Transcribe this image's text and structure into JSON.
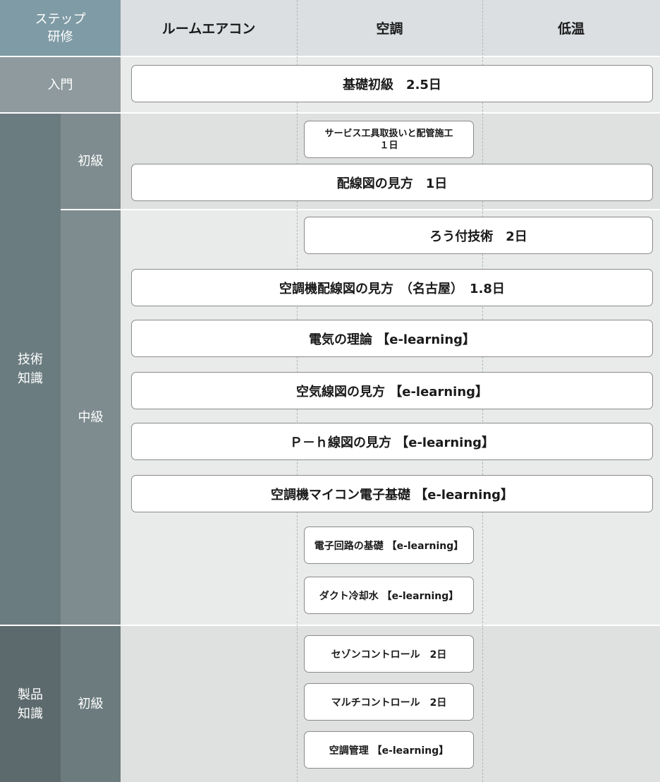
{
  "header": {
    "corner_label": "ステップ\n研修",
    "columns": [
      "ルームエアコン",
      "空調",
      "低温"
    ]
  },
  "rows": {
    "intro": {
      "label": "入門"
    },
    "tech": {
      "label": "技術\n知識",
      "beginner_label": "初級",
      "intermediate_label": "中級"
    },
    "product": {
      "label": "製品\n知識",
      "beginner_label": "初級"
    }
  },
  "courses": [
    "基礎初級　2.5日",
    "サービス工具取扱いと配管施工\n１日",
    "配線図の見方　1日",
    "ろう付技術　2日",
    "空調機配線図の見方　（名古屋）　1.8日",
    "電気の理論 【e-learning】",
    "空気線図の見方 【e-learning】",
    "Ｐ－ｈ線図の見方 【e-learning】",
    "空調機マイコン電子基礎 【e-learning】",
    "電子回路の基礎 【e-learning】",
    "ダクト冷却水 【e-learning】",
    "セゾンコントロール　2日",
    "マルチコントロール　2日",
    "空調管理 【e-learning】"
  ],
  "colors": {
    "header_corner": "#7f9ba5",
    "header_band": "#dbdfe1",
    "intro_label": "#8e9a9e",
    "tech_label": "#6b7c80",
    "tech_sub_label": "#7e8b8f",
    "product_label": "#5d6a6d",
    "product_sub_label": "#6b7b7e",
    "intro_band": "#e9eaea",
    "beginner_band": "#dfe0e0",
    "intermediate_band": "#e9eaea",
    "product_band": "#dfe0e0"
  }
}
